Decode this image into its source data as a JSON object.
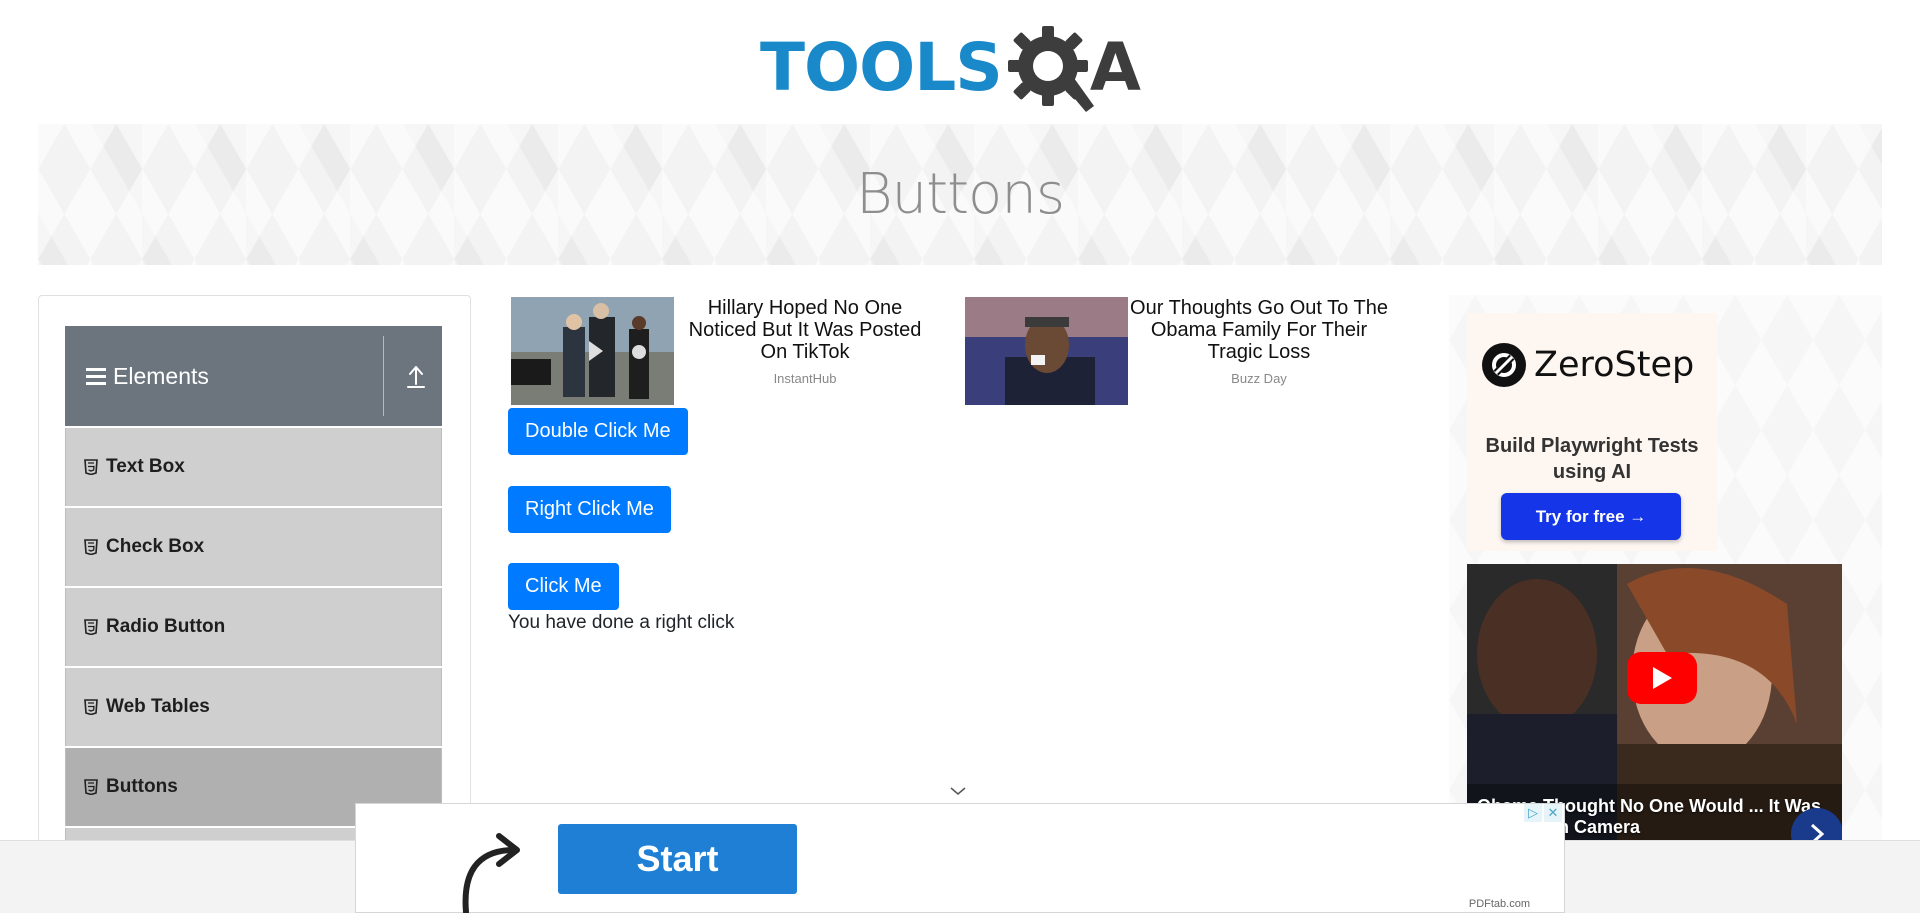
{
  "logo": {
    "brand_left": "TOOLS",
    "brand_right": "A",
    "colors": {
      "blue": "#1989c9",
      "dark": "#3d3d3d"
    }
  },
  "banner": {
    "title": "Buttons"
  },
  "sidebar": {
    "group_title": "Elements",
    "items": [
      {
        "label": "Text Box",
        "icon": "html5-icon",
        "active": false
      },
      {
        "label": "Check Box",
        "icon": "html5-icon",
        "active": false
      },
      {
        "label": "Radio Button",
        "icon": "html5-icon",
        "active": false
      },
      {
        "label": "Web Tables",
        "icon": "html5-icon",
        "active": false
      },
      {
        "label": "Buttons",
        "icon": "html5-icon",
        "active": true
      }
    ]
  },
  "ads": [
    {
      "headline": "Hillary Hoped No One Noticed But It Was Posted On TikTok",
      "source": "InstantHub"
    },
    {
      "headline": "Our Thoughts Go Out To The Obama Family For Their Tragic Loss",
      "source": "Buzz Day"
    }
  ],
  "buttons": {
    "double_click": "Double Click Me",
    "right_click": "Right Click Me",
    "click": "Click Me",
    "accent": "#007bff"
  },
  "result_message": "You have done a right click",
  "right_ad": {
    "brand": "ZeroStep",
    "tagline": "Build Playwright Tests using AI",
    "cta": "Try for free →",
    "video_caption": "Obama Thought No One Would ... It Was Caught On Camera"
  },
  "bottom_ad": {
    "cta": "Start",
    "source": "PDFtab.com"
  }
}
